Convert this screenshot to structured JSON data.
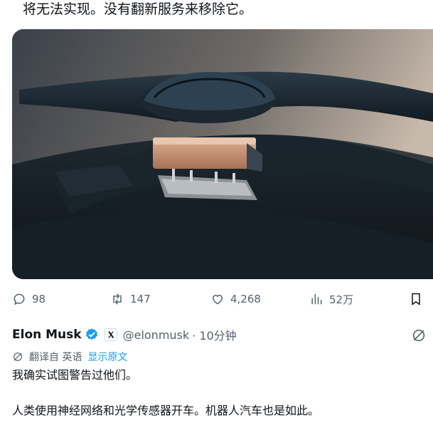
{
  "post": {
    "text_tail": "将无法实现。没有翻新服务来移除它。",
    "image_alt": "car roof lidar sensor module"
  },
  "actions": {
    "reply_count": "98",
    "retweet_count": "147",
    "like_count": "4,268",
    "views_count": "52万"
  },
  "quoted": {
    "name": "Elon Musk",
    "handle": "@elonmusk",
    "time": "· 10分钟",
    "translate_label": "翻译自 英语",
    "show_original": "显示原文",
    "line1": "我确实试图警告过他们。",
    "line2": "人类使用神经网络和光学传感器开车。机器人汽车也是如此。"
  },
  "colors": {
    "text": "#0f1419",
    "secondary": "#536471",
    "accent": "#1d9bf0",
    "verified": "#1d9bf0"
  }
}
